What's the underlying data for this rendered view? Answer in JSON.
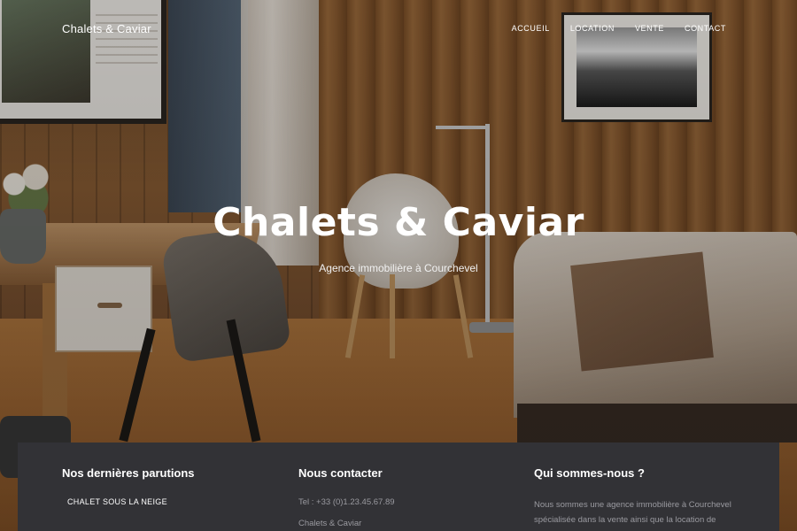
{
  "header": {
    "brand": "Chalets & Caviar",
    "nav": [
      "ACCUEIL",
      "LOCATION",
      "VENTE",
      "CONTACT"
    ]
  },
  "hero": {
    "title": "Chalets & Caviar",
    "subtitle": "Agence immobilière à Courchevel"
  },
  "footer": {
    "recent": {
      "heading": "Nos dernières parutions",
      "items": [
        "CHALET SOUS LA NEIGE"
      ]
    },
    "contact": {
      "heading": "Nous contacter",
      "phone": "Tel : +33 (0)1.23.45.67.89",
      "company": "Chalets & Caviar"
    },
    "about": {
      "heading": "Qui sommes-nous ?",
      "text": "Nous sommes une agence immobilière à Courchevel spécialisée dans la vente ainsi que la location de chalets de luxe. N'hésitez pas à nous"
    }
  },
  "colors": {
    "footer_bg": "#323236",
    "text_light": "#ffffff",
    "text_muted": "#9a9aa0"
  }
}
